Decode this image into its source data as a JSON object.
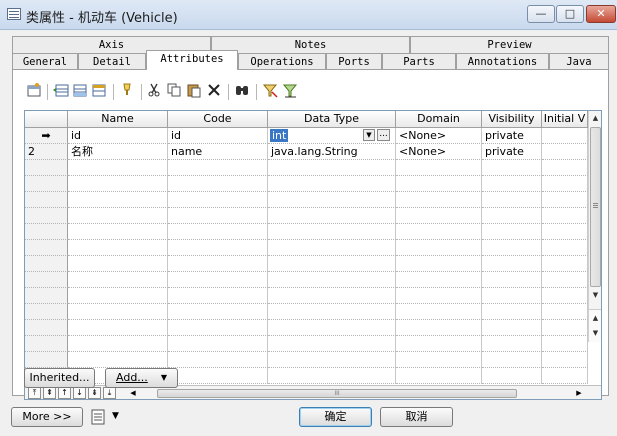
{
  "window": {
    "title": "类属性 - 机动车 (Vehicle)",
    "minimize": "—",
    "maximize": "□",
    "close": "✕"
  },
  "tabs_top": [
    "Axis",
    "Notes",
    "Preview"
  ],
  "tabs_bottom": [
    "General",
    "Detail",
    "Attributes",
    "Operations",
    "Ports",
    "Parts",
    "Annotations",
    "Java"
  ],
  "active_tab": "Attributes",
  "toolbar": [
    "properties-icon",
    "insert-row-icon",
    "add-row-icon",
    "add-attributes-icon",
    "find-icon",
    "cut-icon",
    "copy-icon",
    "paste-icon",
    "delete-icon",
    "binoculars-icon",
    "filter-icon",
    "customize-filter-icon"
  ],
  "grid": {
    "columns": [
      "Name",
      "Code",
      "Data Type",
      "Domain",
      "Visibility",
      "Initial V"
    ],
    "rows": [
      {
        "marker": "➡",
        "name": "id",
        "code": "id",
        "data_type": "int",
        "domain": "<None>",
        "visibility": "private",
        "initial": ""
      },
      {
        "marker": "2",
        "name": "名称",
        "code": "name",
        "data_type": "java.lang.String",
        "domain": "<None>",
        "visibility": "private",
        "initial": ""
      }
    ],
    "ellipsis": "...",
    "hscroll_grip": "III"
  },
  "buttons": {
    "inherited": "Inherited...",
    "add": "Add...",
    "more": "More >>",
    "ok": "确定",
    "cancel": "取消"
  }
}
